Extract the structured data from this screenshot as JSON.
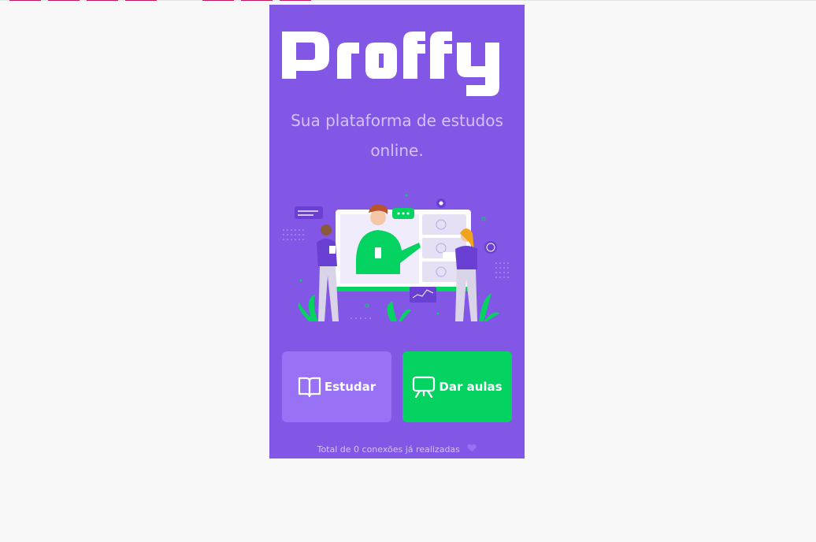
{
  "app": {
    "brand": "Proffy",
    "tagline": "Sua plataforma de estudos online.",
    "footer_text": "Total de 0 conexões já realizadas"
  },
  "actions": {
    "study_label": "Estudar",
    "teach_label": "Dar aulas"
  },
  "icons": {
    "study": "book-icon",
    "teach": "presentation-board-icon",
    "footer": "heart-icon"
  },
  "colors": {
    "background": "#8257e5",
    "study_button": "#9871f5",
    "teach_button": "#04d361",
    "text_light": "#d4c2ff"
  }
}
